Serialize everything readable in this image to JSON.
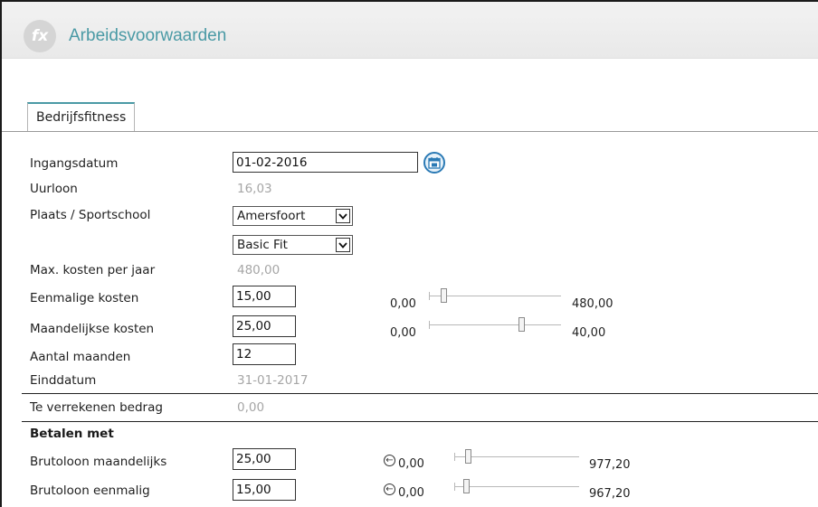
{
  "header": {
    "title": "Arbeidsvoorwaarden",
    "logo_text": "fx"
  },
  "tabs": [
    {
      "label": "Bedrijfsfitness"
    }
  ],
  "form": {
    "ingangsdatum": {
      "label": "Ingangsdatum",
      "value": "01-02-2016"
    },
    "uurloon": {
      "label": "Uurloon",
      "value": "16,03"
    },
    "plaats": {
      "label": "Plaats / Sportschool",
      "selected": "Amersfoort"
    },
    "sportschool": {
      "selected": "Basic Fit"
    },
    "max_kosten": {
      "label": "Max. kosten per jaar",
      "value": "480,00"
    },
    "eenmalige_kosten": {
      "label": "Eenmalige kosten",
      "value": "15,00",
      "min": "0,00",
      "max": "480,00",
      "slider_fraction": 0.031
    },
    "maandelijkse_kosten": {
      "label": "Maandelijkse kosten",
      "value": "25,00",
      "min": "0,00",
      "max": "40,00",
      "slider_fraction": 0.625
    },
    "aantal_maanden": {
      "label": "Aantal maanden",
      "value": "12"
    },
    "einddatum": {
      "label": "Einddatum",
      "value": "31-01-2017"
    },
    "te_verrekenen": {
      "label": "Te verrekenen bedrag",
      "value": "0,00"
    }
  },
  "betalen_met": {
    "title": "Betalen met",
    "brutoloon_maandelijks": {
      "label": "Brutoloon maandelijks",
      "value": "25,00",
      "min": "0,00",
      "max": "977,20",
      "slider_fraction": 0.026
    },
    "brutoloon_eenmalig": {
      "label": "Brutoloon eenmalig",
      "value": "15,00",
      "min": "0,00",
      "max": "967,20",
      "slider_fraction": 0.016
    }
  },
  "colors": {
    "accent": "#4a9aa5",
    "calendar": "#2b7ab5",
    "muted": "#a6a6a6"
  },
  "icons": {
    "calendar": "calendar-icon",
    "undo": "undo-circle-icon",
    "dropdown": "chevron-down-icon"
  }
}
